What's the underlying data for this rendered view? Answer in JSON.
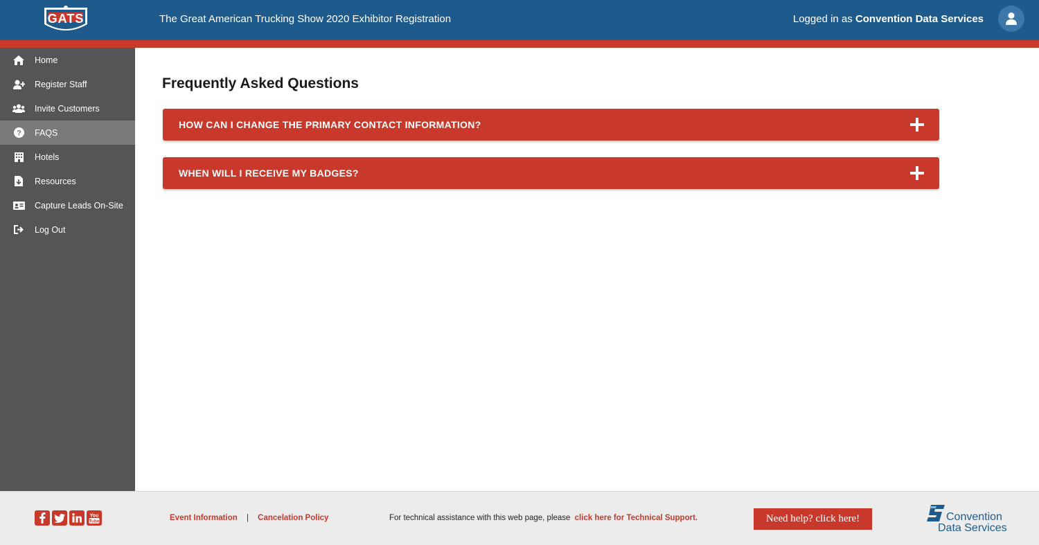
{
  "header": {
    "logo_text": "GATS",
    "title": "The Great American Trucking Show 2020 Exhibitor Registration",
    "logged_in_prefix": "Logged in as",
    "logged_in_user": "Convention Data Services"
  },
  "sidebar": {
    "items": [
      {
        "label": "Home",
        "icon": "home-icon"
      },
      {
        "label": "Register Staff",
        "icon": "user-plus-icon"
      },
      {
        "label": "Invite Customers",
        "icon": "users-icon"
      },
      {
        "label": "FAQS",
        "icon": "question-circle-icon",
        "active": true
      },
      {
        "label": "Hotels",
        "icon": "building-icon"
      },
      {
        "label": "Resources",
        "icon": "file-download-icon"
      },
      {
        "label": "Capture Leads On-Site",
        "icon": "id-card-icon"
      },
      {
        "label": "Log Out",
        "icon": "sign-out-icon"
      }
    ]
  },
  "main": {
    "title": "Frequently Asked Questions",
    "faqs": [
      {
        "question": "HOW CAN I CHANGE THE PRIMARY CONTACT INFORMATION?"
      },
      {
        "question": "WHEN WILL I RECEIVE MY BADGES?"
      }
    ]
  },
  "footer": {
    "social": [
      "facebook-icon",
      "twitter-icon",
      "linkedin-icon",
      "youtube-icon"
    ],
    "event_info": "Event Information",
    "separator": "|",
    "cancel_policy": "Cancelation Policy",
    "tech_text": "For technical assistance with this web page, please",
    "tech_link": "click here for Technical Support.",
    "help_button": "Need help? click here!",
    "cds_line1": "Convention",
    "cds_line2": "Data Services"
  },
  "colors": {
    "header_blue": "#1f5a8c",
    "accent_red": "#c8392b",
    "sidebar_gray": "#555555",
    "sidebar_active": "#7a7a7a"
  }
}
